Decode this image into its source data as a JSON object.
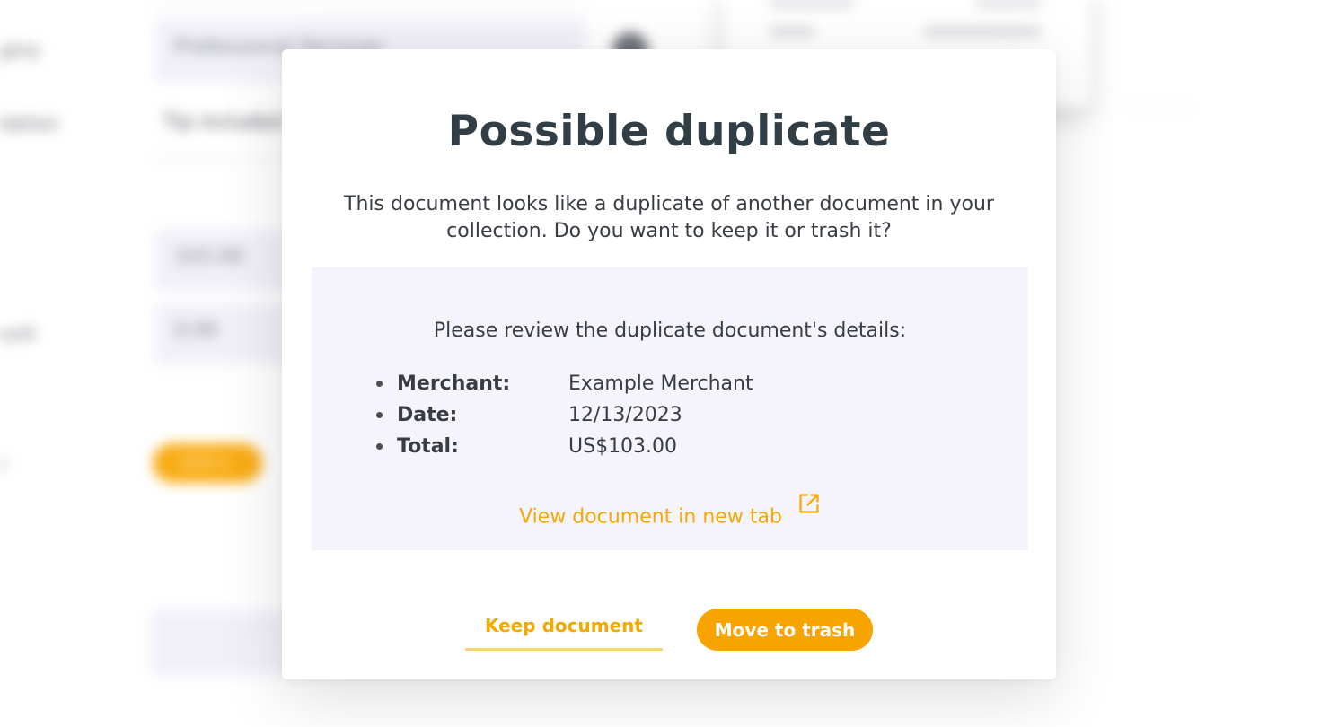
{
  "modal": {
    "title": "Possible duplicate",
    "description": "This document looks like a duplicate of another document in your collection. Do you want to keep it or trash it?",
    "details_heading": "Please review the duplicate document's details:",
    "details": [
      {
        "label": "Merchant:",
        "value": "Example Merchant"
      },
      {
        "label": "Date:",
        "value": "12/13/2023"
      },
      {
        "label": "Total:",
        "value": "US$103.00"
      }
    ],
    "view_link_label": "View document in new tab",
    "view_link_icon": "external-link-icon",
    "keep_label": "Keep document",
    "trash_label": "Move to trash"
  },
  "colors": {
    "accent": "#f8a400",
    "title": "#323e45",
    "panel_background": "#f5f4fd",
    "text": "#383d44"
  }
}
